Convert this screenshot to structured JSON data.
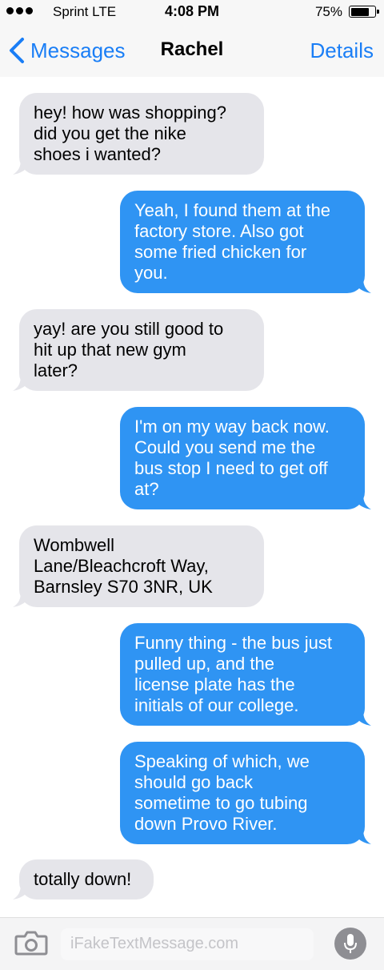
{
  "status": {
    "carrier": "Sprint  LTE",
    "time": "4:08 PM",
    "battery_text": "75%",
    "battery_level": 0.75
  },
  "nav": {
    "back_label": "Messages",
    "title": "Rachel",
    "details_label": "Details"
  },
  "messages": [
    {
      "direction": "incoming",
      "text": "hey! how was shopping?\ndid you get the nike\nshoes i wanted?"
    },
    {
      "direction": "outgoing",
      "text": "Yeah, I found them at the\nfactory store. Also got\nsome fried chicken for\nyou."
    },
    {
      "direction": "incoming",
      "text": "yay! are you still good to\nhit up that new gym\nlater?"
    },
    {
      "direction": "outgoing",
      "text": "I'm on my way back now.\nCould you send me the\nbus stop I need to get off\nat?"
    },
    {
      "direction": "incoming",
      "text": "Wombwell\nLane/Bleachcroft Way,\nBarnsley S70 3NR, UK"
    },
    {
      "direction": "outgoing",
      "text": "Funny thing - the bus just\npulled up, and the\nlicense plate has the\ninitials of our college."
    },
    {
      "direction": "outgoing",
      "text": "Speaking of which, we\nshould go back\nsometime to go tubing\ndown Provo River."
    },
    {
      "direction": "incoming",
      "text": "totally down!"
    }
  ],
  "input": {
    "placeholder": "iFakeTextMessage.com"
  },
  "colors": {
    "incoming_bubble": "#e5e5ea",
    "outgoing_bubble": "#2f94f3",
    "accent": "#1a7ef6"
  },
  "icons": {
    "back": "chevron-left-icon",
    "camera": "camera-icon",
    "mic": "microphone-icon"
  }
}
